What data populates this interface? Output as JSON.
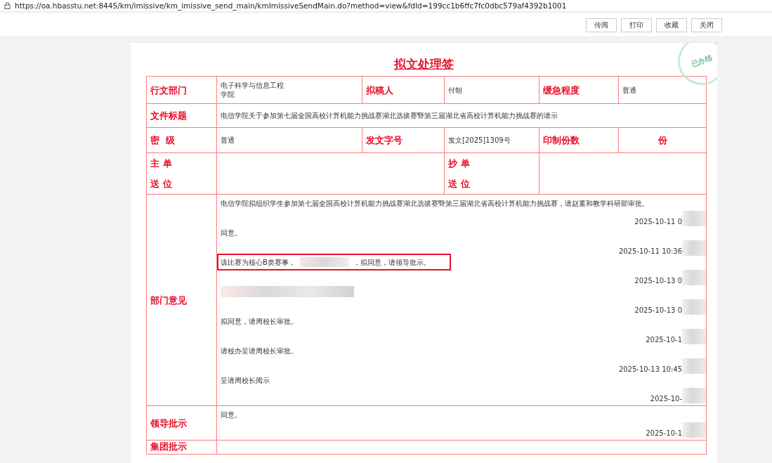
{
  "address_bar": {
    "url": "https://oa.hbasstu.net:8445/km/imissive/km_imissive_send_main/kmImissiveSendMain.do?method=view&fdId=199cc1b6ffc7fc0dbc579af4392b1001"
  },
  "toolbar": {
    "buttons": [
      "传阅",
      "打印",
      "收藏",
      "关闭"
    ]
  },
  "stamp": {
    "text": "已办结"
  },
  "form": {
    "title": "拟文处理签",
    "rows": [
      {
        "cells": [
          {
            "kind": "label",
            "text": "行文部门"
          },
          {
            "kind": "value",
            "text": "电子科学与信息工程学院"
          },
          {
            "kind": "label",
            "text": "拟稿人"
          },
          {
            "kind": "value",
            "text": "付朝"
          },
          {
            "kind": "label",
            "text": "缓急程度"
          },
          {
            "kind": "value",
            "text": "普通"
          }
        ]
      },
      {
        "cells": [
          {
            "kind": "label",
            "text": "文件标题"
          },
          {
            "kind": "value",
            "text": "电信学院关于参加第七届全国高校计算机能力挑战赛湖北选拔赛暨第三届湖北省高校计算机能力挑战赛的请示"
          }
        ]
      },
      {
        "cells": [
          {
            "kind": "label",
            "text": "密  级"
          },
          {
            "kind": "value",
            "text": "普通"
          },
          {
            "kind": "label",
            "text": "发文字号"
          },
          {
            "kind": "value",
            "text": "发文[2025]1309号"
          },
          {
            "kind": "label",
            "text": "印制份数"
          },
          {
            "kind": "unit",
            "text": "份"
          }
        ]
      },
      {
        "cells": [
          {
            "kind": "lines",
            "lines": [
              "主 单",
              "送 位"
            ]
          },
          {
            "kind": "value",
            "text": ""
          },
          {
            "kind": "value",
            "text": ""
          },
          {
            "kind": "lines",
            "lines": [
              "抄 单",
              "送 位"
            ]
          },
          {
            "kind": "value",
            "text": ""
          },
          {
            "kind": "value",
            "text": ""
          }
        ]
      }
    ],
    "sections": [
      {
        "label": "部门意见",
        "entries": [
          {
            "text": "电信学院拟组织学生参加第七届全国高校计算机能力挑战赛湖北选拔赛暨第三届湖北省高校计算机能力挑战赛，请赵董和教学科研部审批。",
            "time": "2025-10-11 0"
          },
          {
            "text": "同意。",
            "time": "2025-10-11 10:36"
          },
          {
            "text": "该比赛为核心B类赛事，",
            "redacted": true,
            "text_after": "，拟同意，请领导批示。",
            "highlighted": true,
            "time": "2025-10-13 0"
          },
          {
            "redacted": true,
            "time": "2025-10-13 0"
          },
          {
            "text": "拟同意，请周校长审批。",
            "time": "2025-10-1"
          },
          {
            "text": "请校办呈请周校长审批。",
            "time": "2025-10-13 10:45"
          },
          {
            "text": "呈请周校长阅示",
            "time": "2025-10-"
          }
        ]
      },
      {
        "label": "领导批示",
        "entries": [
          {
            "text": "同意。",
            "time": "2025-10-1"
          }
        ]
      },
      {
        "label": "集团批示"
      }
    ]
  }
}
